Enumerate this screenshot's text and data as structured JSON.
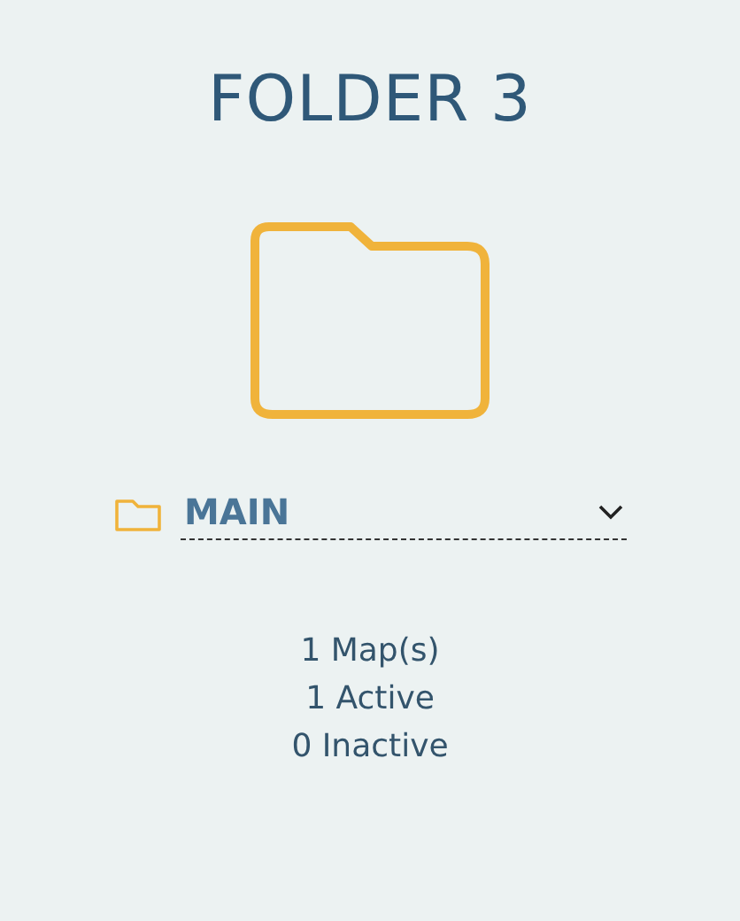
{
  "title": "FOLDER 3",
  "folder_select": {
    "value": "MAIN"
  },
  "stats": [
    "1 Map(s)",
    "1 Active",
    "0 Inactive"
  ]
}
